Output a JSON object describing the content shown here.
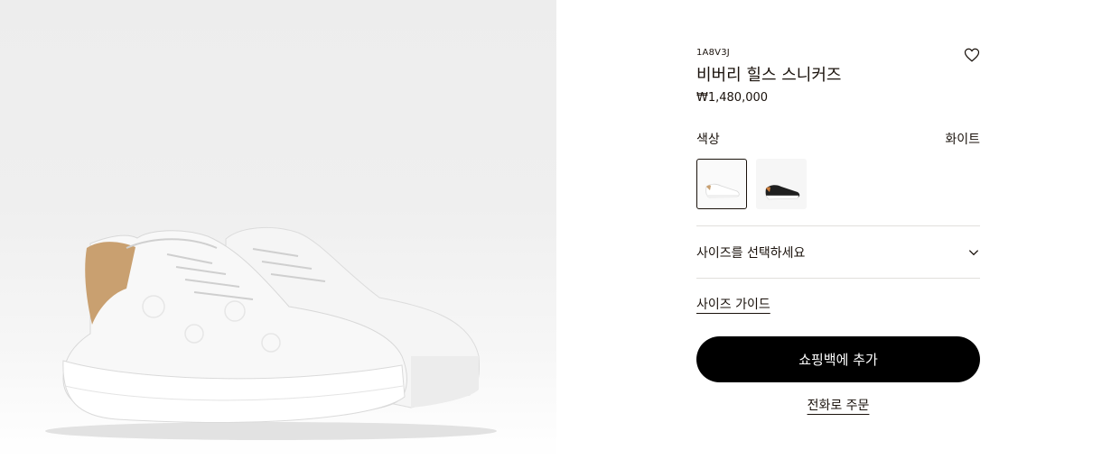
{
  "product": {
    "sku": "1A8V3J",
    "name": "비버리 힐스 스니커즈",
    "price": "₩1,480,000"
  },
  "color": {
    "label": "색상",
    "selected": "화이트",
    "swatches": [
      {
        "name": "white",
        "selected": true
      },
      {
        "name": "black",
        "selected": false
      }
    ]
  },
  "size": {
    "select_label": "사이즈를 선택하세요",
    "guide_label": "사이즈 가이드"
  },
  "actions": {
    "add_to_bag": "쇼핑백에 추가",
    "phone_order": "전화로 주문"
  },
  "icons": {
    "wishlist": "heart-icon",
    "size_dropdown": "chevron-down-icon"
  },
  "colors": {
    "accent": "#000000",
    "text": "#19110b",
    "divider": "#e1dfdc",
    "heel_tab": "#c9a070"
  }
}
